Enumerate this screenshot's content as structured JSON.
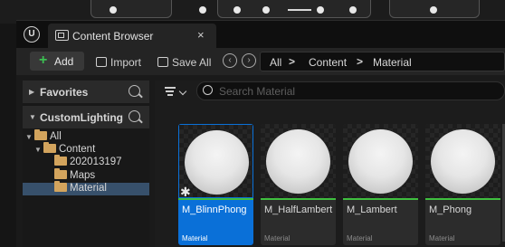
{
  "window": {
    "tab_title": "Content Browser",
    "tab_close": "×",
    "logo": "U"
  },
  "toolbar": {
    "add_label": "Add",
    "add_icon": "+",
    "import_label": "Import",
    "save_all_label": "Save All",
    "back_icon": "‹",
    "forward_icon": "›"
  },
  "breadcrumb": {
    "items": [
      "All",
      "Content",
      "Material"
    ],
    "separator": ">"
  },
  "sidebar": {
    "favorites_label": "Favorites",
    "project_label": "CustomLighting",
    "tree": [
      {
        "label": "All"
      },
      {
        "label": "Content"
      },
      {
        "label": "202013197"
      },
      {
        "label": "Maps"
      },
      {
        "label": "Material"
      }
    ]
  },
  "content": {
    "search_placeholder": "Search Material",
    "assets": [
      {
        "name": "M_BlinnPhong",
        "type": "Material",
        "selected": true
      },
      {
        "name": "M_HalfLambert",
        "type": "Material",
        "selected": false
      },
      {
        "name": "M_Lambert",
        "type": "Material",
        "selected": false
      },
      {
        "name": "M_Phong",
        "type": "Material",
        "selected": false
      }
    ]
  },
  "colors": {
    "accent_selection": "#0a70d8",
    "material_bar": "#3fbf3f",
    "folder": "#d3a45d",
    "add_plus": "#3cbf52"
  },
  "icons": [
    "unreal-logo-icon",
    "content-browser-icon",
    "close-icon",
    "plus-icon",
    "import-icon",
    "save-icon",
    "back-icon",
    "forward-icon",
    "search-icon",
    "filter-icon",
    "folder-icon",
    "caret-icon"
  ]
}
